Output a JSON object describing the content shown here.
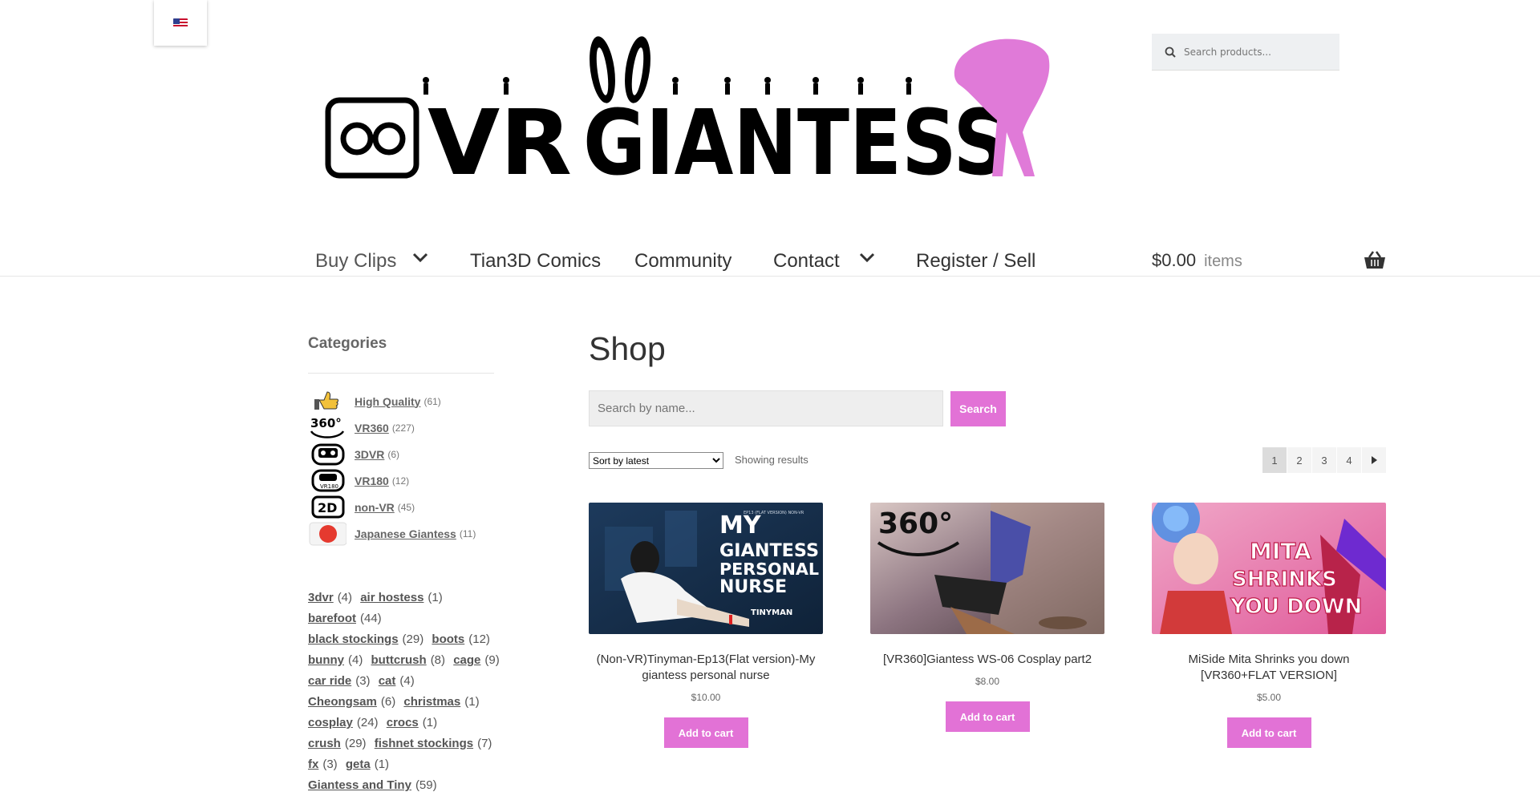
{
  "language": {
    "flag": "us-flag-icon"
  },
  "logo": {
    "text": "VR GIANTESS",
    "color": "#000000",
    "figure_color": "#e07ad8"
  },
  "header_search": {
    "placeholder": "Search products..."
  },
  "nav": {
    "items": [
      {
        "label": "Buy Clips",
        "has_dropdown": true
      },
      {
        "label": "Tian3D Comics",
        "has_dropdown": false
      },
      {
        "label": "Community",
        "has_dropdown": false
      },
      {
        "label": "Contact",
        "has_dropdown": true
      },
      {
        "label": "Register / Sell",
        "has_dropdown": false
      }
    ],
    "cart": {
      "amount": "$0.00",
      "items_label": "items",
      "icon": "basket-icon"
    }
  },
  "sidebar": {
    "categories_title": "Categories",
    "categories": [
      {
        "label": "High Quality",
        "count": "(61)",
        "icon": "thumbs-up-icon"
      },
      {
        "label": "VR360",
        "count": "(227)",
        "icon": "360-icon"
      },
      {
        "label": "3DVR",
        "count": "(6)",
        "icon": "vr-headset-icon"
      },
      {
        "label": "VR180",
        "count": "(12)",
        "icon": "vr180-icon"
      },
      {
        "label": "non-VR",
        "count": "(45)",
        "icon": "2d-icon"
      },
      {
        "label": "Japanese Giantess",
        "count": "(11)",
        "icon": "japan-flag-icon"
      }
    ],
    "tag_lines": [
      [
        {
          "label": "3dvr",
          "count": "(4)"
        },
        {
          "label": "air hostess",
          "count": "(1)"
        }
      ],
      [
        {
          "label": "barefoot",
          "count": "(44)"
        }
      ],
      [
        {
          "label": "black stockings",
          "count": "(29)"
        },
        {
          "label": "boots",
          "count": "(12)"
        }
      ],
      [
        {
          "label": "bunny",
          "count": "(4)"
        },
        {
          "label": "buttcrush",
          "count": "(8)"
        },
        {
          "label": "cage",
          "count": "(9)"
        }
      ],
      [
        {
          "label": "car ride",
          "count": "(3)"
        },
        {
          "label": "cat",
          "count": "(4)"
        }
      ],
      [
        {
          "label": "Cheongsam",
          "count": "(6)"
        },
        {
          "label": "christmas",
          "count": "(1)"
        }
      ],
      [
        {
          "label": "cosplay",
          "count": "(24)"
        },
        {
          "label": "crocs",
          "count": "(1)"
        }
      ],
      [
        {
          "label": "crush",
          "count": "(29)"
        },
        {
          "label": "fishnet stockings",
          "count": "(7)"
        }
      ],
      [
        {
          "label": "fx",
          "count": "(3)"
        },
        {
          "label": "geta",
          "count": "(1)"
        }
      ],
      [
        {
          "label": "Giantess and Tiny",
          "count": "(59)"
        }
      ]
    ]
  },
  "main": {
    "title": "Shop",
    "name_search": {
      "placeholder": "Search by name...",
      "button": "Search"
    },
    "sort": {
      "selected": "Sort by latest"
    },
    "showing": "Showing results",
    "pagination": {
      "pages": [
        "1",
        "2",
        "3",
        "4"
      ],
      "current": "1",
      "next_icon": "arrow-right-icon"
    },
    "accent_color": "#e272d6",
    "products": [
      {
        "name": "(Non-VR)Tinyman-Ep13(Flat version)-My giantess personal nurse",
        "price": "$10.00",
        "button": "Add to cart",
        "thumb_text": [
          "MY",
          "GIANTESS",
          "PERSONAL",
          "NURSE"
        ],
        "thumb_sub": "EP13 (FLAT VERSION) NON-VR",
        "thumb_brand": "TINYMAN"
      },
      {
        "name": "[VR360]Giantess WS-06 Cosplay part2",
        "price": "$8.00",
        "button": "Add to cart",
        "thumb_text": [
          "360°"
        ]
      },
      {
        "name": "MiSide Mita Shrinks you down [VR360+FLAT VERSION]",
        "price": "$5.00",
        "button": "Add to cart",
        "thumb_text": [
          "MITA",
          "SHRINKS",
          "YOU DOWN"
        ]
      }
    ]
  }
}
